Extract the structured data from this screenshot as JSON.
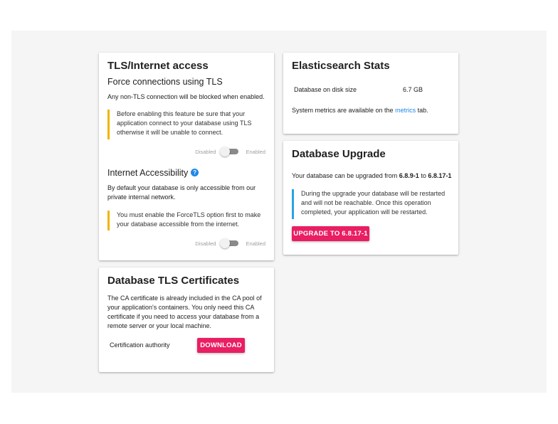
{
  "colors": {
    "accent": "#e91e63",
    "warning_bar": "#f0b400",
    "info_bar": "#29a3e0",
    "link": "#1e88e5",
    "background": "#f5f5f5"
  },
  "tls": {
    "title": "TLS/Internet access",
    "force_heading": "Force connections using TLS",
    "force_desc": "Any non-TLS connection will be blocked when enabled.",
    "force_warning": "Before enabling this feature be sure that your application connect to your database using TLS otherwise it will be unable to connect.",
    "toggle_off_label": "Disabled",
    "toggle_on_label": "Enabled",
    "force_enabled": false,
    "internet_heading": "Internet Accessibility",
    "help_icon": "?",
    "internet_desc": "By default your database is only accessible from our private internal network.",
    "internet_warning": "You must enable the ForceTLS option first to make your database accessible from the internet.",
    "internet_enabled": false
  },
  "certs": {
    "title": "Database TLS Certificates",
    "desc": "The CA certificate is already included in the CA pool of your application's containers. You only need this CA certificate if you need to access your database from a remote server or your local machine.",
    "ca_label": "Certification authority",
    "download_label": "DOWNLOAD"
  },
  "stats": {
    "title": "Elasticsearch Stats",
    "disk_label": "Database on disk size",
    "disk_value": "6.7 GB",
    "metrics_prefix": "System metrics are available on the ",
    "metrics_link": "metrics",
    "metrics_suffix": " tab."
  },
  "upgrade": {
    "title": "Database Upgrade",
    "line_prefix": "Your database can be upgraded from ",
    "from_version": "6.8.9-1",
    "line_mid": " to ",
    "to_version": "6.8.17-1",
    "info": "During the upgrade your database will be restarted and will not be reachable. Once this operation completed, your application will be restarted.",
    "button_label": "UPGRADE TO 6.8.17-1"
  }
}
